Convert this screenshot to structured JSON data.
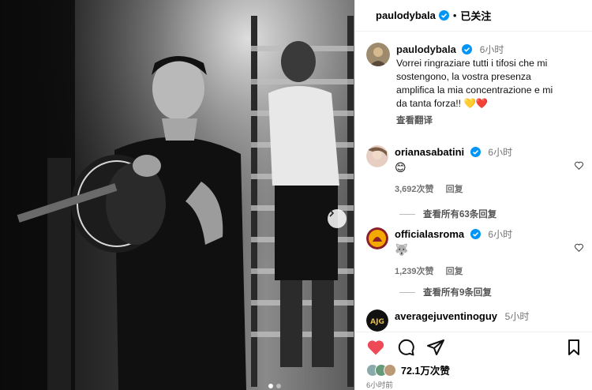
{
  "post": {
    "author": "paulodybala",
    "follow_status": "已关注",
    "separator": "•",
    "caption_lines": [
      "Vorrei ringraziare tutti i tifosi che mi",
      "sostengono, la vostra presenza",
      "amplifica la mia concentrazione e mi",
      "da tanta forza!! 💛❤️"
    ],
    "caption_time": "6小时",
    "see_translation": "查看翻译",
    "likes": "72.1万次赞",
    "post_time": "6小时前"
  },
  "comments": [
    {
      "user": "orianasabatini",
      "time": "6小时",
      "text": "😊",
      "likes": "3,692次赞",
      "reply": "回复",
      "view_replies": "查看所有63条回复"
    },
    {
      "user": "officialasroma",
      "time": "6小时",
      "text": "🐺",
      "likes": "1,239次赞",
      "reply": "回复",
      "view_replies": "查看所有9条回复"
    },
    {
      "user": "averagejuventinoguy",
      "time": "5小时",
      "text": ""
    }
  ],
  "colors": {
    "like_red": "#ed4956",
    "verified_blue": "#0095f6"
  },
  "icons": [
    "verified-badge-icon",
    "heart-filled-icon",
    "comment-icon",
    "share-icon",
    "bookmark-icon",
    "heart-outline-icon",
    "chevron-right-icon"
  ]
}
